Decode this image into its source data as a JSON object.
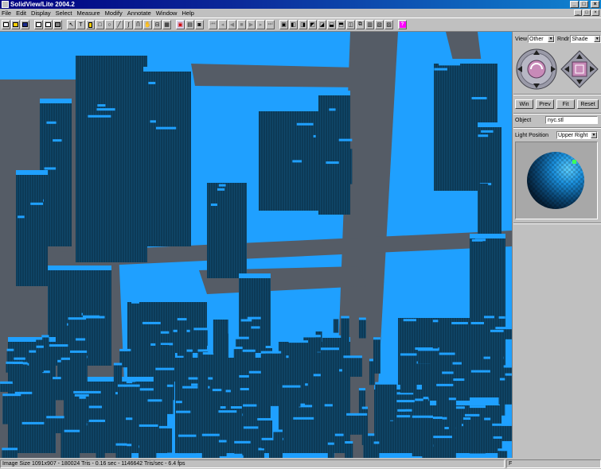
{
  "window": {
    "title": "SolidView/Lite 2004.2",
    "min_label": "_",
    "max_label": "□",
    "close_label": "×"
  },
  "menu": [
    "File",
    "Edit",
    "Display",
    "Select",
    "Measure",
    "Modify",
    "Annotate",
    "Window",
    "Help"
  ],
  "mdi_controls": [
    "_",
    "□",
    "×"
  ],
  "toolbar": {
    "text_tool_label": "T",
    "help_label": "?"
  },
  "panel": {
    "view_label": "View",
    "view_value": "Other",
    "rndr_label": "Rndr",
    "rndr_value": "Shade",
    "buttons": [
      "Win",
      "Prev",
      "Fit",
      "Reset"
    ],
    "object_label": "Object",
    "object_value": "nyc.stl",
    "light_label": "Light Position",
    "light_value": "Upper Right"
  },
  "status": {
    "info": "Image Size 1091x907 - 180024 Tris - 0.16 sec - 1146642 Tris/sec - 6.4 fps",
    "mode": "F"
  },
  "colors": {
    "building_top": "#1fa0ff",
    "building_side": "#0c3a57",
    "street": "#555c66",
    "title_gradient_start": "#000080",
    "title_gradient_end": "#1084d0"
  }
}
